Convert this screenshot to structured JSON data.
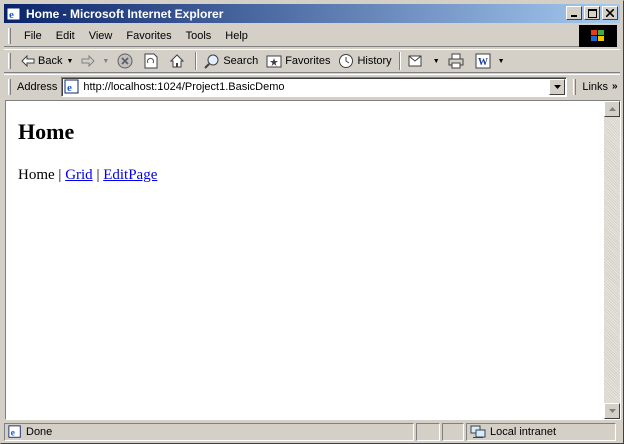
{
  "window": {
    "title": "Home - Microsoft Internet Explorer"
  },
  "menu": [
    "File",
    "Edit",
    "View",
    "Favorites",
    "Tools",
    "Help"
  ],
  "toolbar": {
    "back_label": "Back",
    "search_label": "Search",
    "favorites_label": "Favorites",
    "history_label": "History"
  },
  "address": {
    "label": "Address",
    "url": "http://localhost:1024/Project1.BasicDemo",
    "links_label": "Links"
  },
  "page": {
    "heading": "Home",
    "nav_current": "Home",
    "separator": "|",
    "nav_links": [
      "Grid",
      "EditPage"
    ]
  },
  "status": {
    "text": "Done",
    "zone": "Local intranet"
  },
  "colors": {
    "titlebar_start": "#0a246a",
    "titlebar_end": "#a6caf0",
    "link": "#0000ee",
    "chrome": "#d4d0c8"
  }
}
